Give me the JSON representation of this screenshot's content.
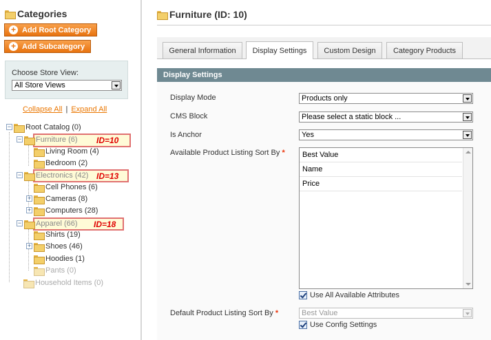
{
  "sidebar": {
    "title": "Categories",
    "add_root_label": "Add Root Category",
    "add_sub_label": "Add Subcategory",
    "store_view_label": "Choose Store View:",
    "store_view_value": "All Store Views",
    "collapse_all": "Collapse All",
    "separator": "|",
    "expand_all": "Expand All"
  },
  "tree": {
    "root": "Root Catalog (0)",
    "furniture": "Furniture (6)",
    "living_room": "Living Room (4)",
    "bedroom": "Bedroom (2)",
    "electronics": "Electronics (42)",
    "cell_phones": "Cell Phones (6)",
    "cameras": "Cameras (8)",
    "computers": "Computers (28)",
    "apparel": "Apparel (66)",
    "shirts": "Shirts (19)",
    "shoes": "Shoes (46)",
    "hoodies": "Hoodies (1)",
    "pants": "Pants (0)",
    "household": "Household Items (0)"
  },
  "annotations": {
    "furniture_id": "ID=10",
    "electronics_id": "ID=13",
    "apparel_id": "ID=18"
  },
  "main": {
    "title": "Furniture (ID: 10)",
    "tabs": [
      {
        "label": "General Information"
      },
      {
        "label": "Display Settings"
      },
      {
        "label": "Custom Design"
      },
      {
        "label": "Category Products"
      }
    ],
    "section_title": "Display Settings",
    "fields": {
      "display_mode_label": "Display Mode",
      "display_mode_value": "Products only",
      "cms_block_label": "CMS Block",
      "cms_block_value": "Please select a static block ...",
      "is_anchor_label": "Is Anchor",
      "is_anchor_value": "Yes",
      "sort_by_label": "Available Product Listing Sort By",
      "sort_by_options": [
        "Best Value",
        "Name",
        "Price"
      ],
      "use_all_label": "Use All Available Attributes",
      "default_sort_label": "Default Product Listing Sort By",
      "default_sort_value": "Best Value",
      "use_config_label": "Use Config Settings",
      "required_mark": "*"
    }
  },
  "colors": {
    "accent_orange": "#e8730f",
    "section_header": "#6f8992",
    "highlight_border": "#e07070",
    "annotation_red": "#e00000"
  }
}
